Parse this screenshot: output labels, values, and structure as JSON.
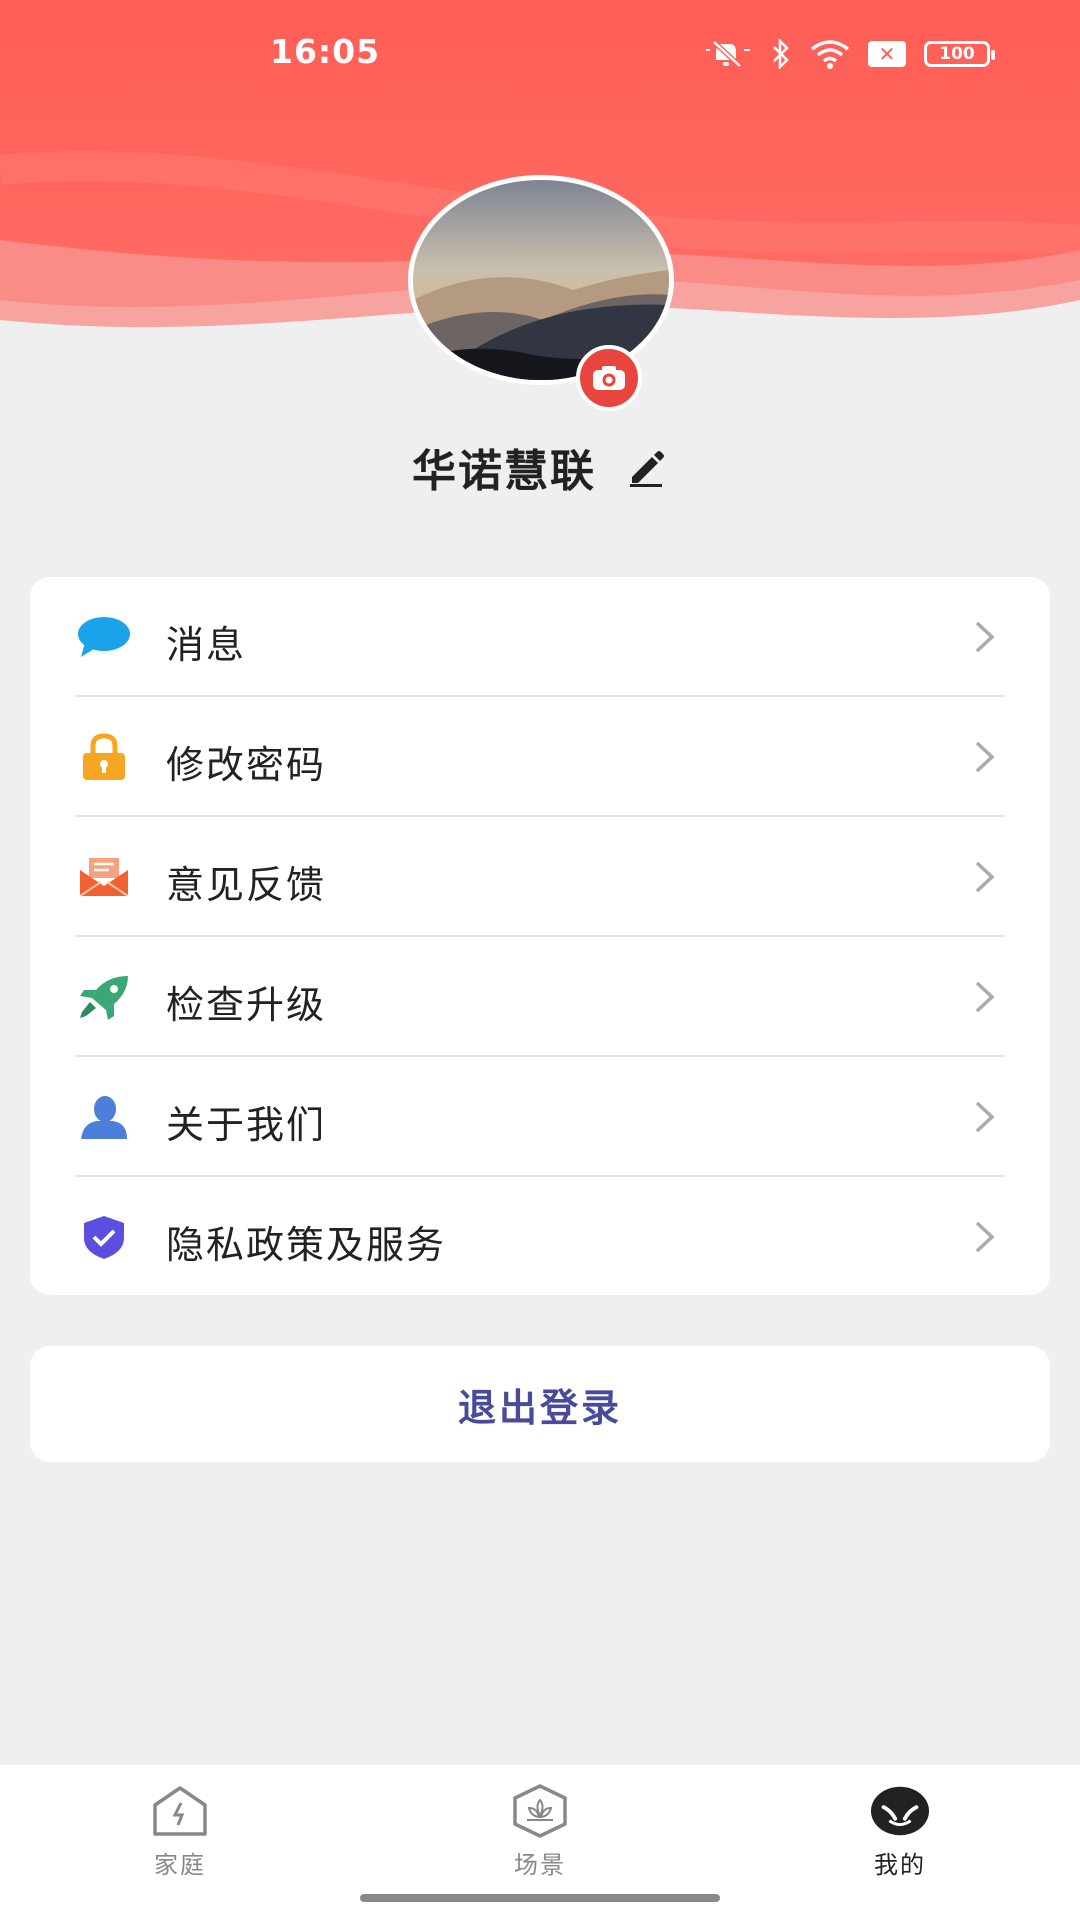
{
  "status_bar": {
    "time": "16:05",
    "battery": "100",
    "icons": [
      "mute-icon",
      "bluetooth-icon",
      "wifi-icon",
      "no-sim-icon",
      "battery-icon"
    ]
  },
  "colors": {
    "header_red": "#ff5a52",
    "camera_badge": "#e9443d",
    "logout_text": "#4a4a9c",
    "message_icon": "#1aa3e8",
    "lock_icon": "#f5a623",
    "feedback_icon": "#f0612f",
    "upgrade_icon": "#3aa874",
    "about_icon": "#4b7fd9",
    "privacy_icon": "#5b4fe0"
  },
  "profile": {
    "name": "华诺慧联",
    "avatar": "landscape-avatar",
    "camera_icon": "camera-icon",
    "edit_icon": "pencil-icon"
  },
  "menu": {
    "items": [
      {
        "label": "消息",
        "icon": "message-bubble-icon"
      },
      {
        "label": "修改密码",
        "icon": "lock-icon"
      },
      {
        "label": "意见反馈",
        "icon": "envelope-icon"
      },
      {
        "label": "检查升级",
        "icon": "rocket-icon"
      },
      {
        "label": "关于我们",
        "icon": "person-icon"
      },
      {
        "label": "隐私政策及服务",
        "icon": "shield-check-icon"
      }
    ]
  },
  "logout": {
    "label": "退出登录"
  },
  "tabs": [
    {
      "label": "家庭",
      "icon": "home-icon",
      "active": false
    },
    {
      "label": "场景",
      "icon": "scene-icon",
      "active": false
    },
    {
      "label": "我的",
      "icon": "profile-face-icon",
      "active": true
    }
  ]
}
